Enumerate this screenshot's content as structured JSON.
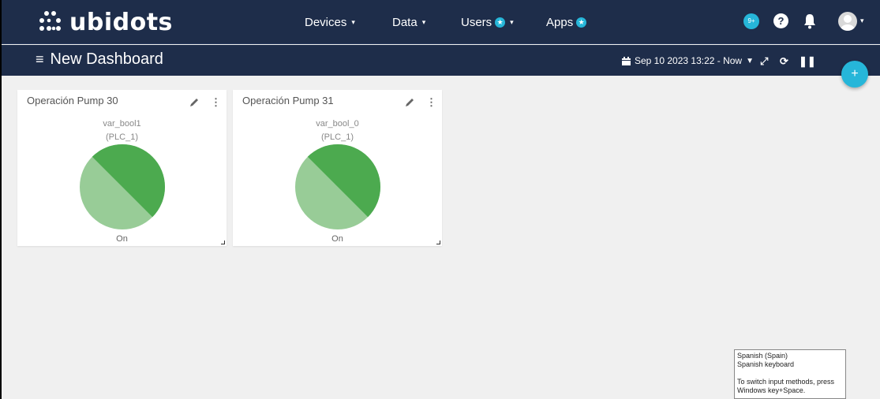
{
  "brand": {
    "name": "ubidots"
  },
  "nav": {
    "devices": "Devices",
    "data": "Data",
    "users": "Users",
    "apps": "Apps"
  },
  "topbar": {
    "notifications_badge": "9+",
    "help": "?"
  },
  "dashboard": {
    "title": "New Dashboard",
    "date_range": "Sep 10 2023 13:22 - Now",
    "add_button": "+"
  },
  "widgets": [
    {
      "title": "Operación Pump 30",
      "variable": "var_bool1",
      "device": "(PLC_1)",
      "state": "On"
    },
    {
      "title": "Operación Pump 31",
      "variable": "var_bool_0",
      "device": "(PLC_1)",
      "state": "On"
    }
  ],
  "colors": {
    "navbar": "#1e2d4a",
    "accent": "#26b6d9",
    "pie_dark": "#4caa4f",
    "pie_light": "#98cc97"
  },
  "tooltip": {
    "line1": "Spanish (Spain)",
    "line2": "Spanish keyboard",
    "line3": "To switch input methods, press Windows key+Space."
  }
}
